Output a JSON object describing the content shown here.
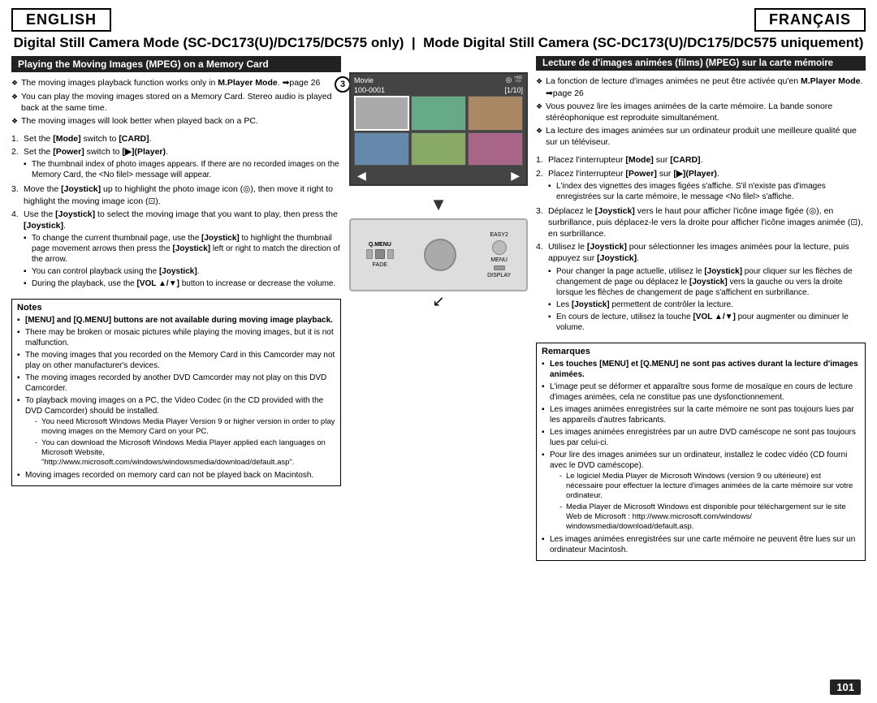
{
  "header": {
    "english_label": "ENGLISH",
    "francais_label": "FRANÇAIS"
  },
  "main_title": {
    "en": "Digital Still Camera Mode (SC-DC173(U)/DC175/DC575 only)",
    "fr": "Mode Digital Still Camera (SC-DC173(U)/DC175/DC575 uniquement)"
  },
  "english_section": {
    "header": "Playing the Moving Images (MPEG) on a Memory Card",
    "intro_bullets": [
      "The moving images playback function works only in M.Player Mode. ➡page 26",
      "You can play the moving images stored on a Memory Card. Stereo audio is played back at the same time.",
      "The moving images will look better when played back on a PC."
    ],
    "steps": [
      {
        "num": "1.",
        "text": "Set the [Mode] switch to [CARD]."
      },
      {
        "num": "2.",
        "text": "Set the [Power] switch to [▶](Player).",
        "subs": [
          "The thumbnail index of photo images appears. If there are no recorded images on the Memory Card, the <No filel> message will appear."
        ]
      },
      {
        "num": "3.",
        "text": "Move the [Joystick] up to highlight the photo image icon (◎), then move it right to highlight the moving image icon (⊡)."
      },
      {
        "num": "4.",
        "text": "Use the [Joystick] to select the moving image that you want to play, then press the [Joystick].",
        "subs": [
          "To change the current thumbnail page, use the [Joystick] to highlight the thumbnail page movement arrows then press the [Joystick] left or right to match the direction of the arrow.",
          "You can control playback using the [Joystick].",
          "During the playback, use the [VOL ▲/▼] button to increase or decrease the volume."
        ]
      }
    ],
    "notes_title": "Notes",
    "notes": [
      {
        "text": "[MENU] and [Q.MENU] buttons are not available during moving image playback.",
        "bold": true
      },
      {
        "text": "There may be broken or mosaic pictures while playing the moving images, but it is not malfunction.",
        "bold": false
      },
      {
        "text": "The moving images that you recorded on the Memory Card in this Camcorder may not play on other manufacturer's devices.",
        "bold": false
      },
      {
        "text": "The moving images recorded by another DVD Camcorder may not play on this DVD Camcorder.",
        "bold": false
      },
      {
        "text": "To playback moving images on a PC, the Video Codec (in the CD provided with the DVD Camcorder) should be installed.",
        "bold": false,
        "subs": [
          "You need Microsoft Windows Media Player Version 9 or higher version in order to play moving images on the Memory Card on your PC.",
          "You can download the Microsoft Windows Media Player applied each languages on Microsoft Website, \"http://www.microsoft.com/windows/windowsmedia/download/default.asp\"."
        ]
      },
      {
        "text": "Moving images recorded on memory card can not be played back on Macintosh.",
        "bold": false
      }
    ]
  },
  "french_section": {
    "header": "Lecture de d'images animées (films) (MPEG) sur la carte mémoire",
    "intro_bullets": [
      "La fonction de lecture d'images animées ne peut être activée qu'en M.Player Mode. ➡page 26",
      "Vous pouvez lire les images animées de la carte mémoire. La bande sonore stéréophonique est reproduite simultanément.",
      "La lecture des images animées sur un ordinateur produit une meilleure qualité que sur un téléviseur."
    ],
    "steps": [
      {
        "num": "1.",
        "text": "Placez l'interrupteur [Mode] sur [CARD]."
      },
      {
        "num": "2.",
        "text": "Placez l'interrupteur [Power] sur [▶](Player).",
        "subs": [
          "L'index des vignettes des images figées s'affiche. S'il n'existe pas d'images enregistrées sur la carte mémoire, le message <No filel> s'affiche."
        ]
      },
      {
        "num": "3.",
        "text": "Déplacez le [Joystick] vers le haut pour afficher l'icône image figée (◎), en surbrillance, puis déplacez-le vers la droite pour afficher l'icône images animée (⊡), en surbrillance."
      },
      {
        "num": "4.",
        "text": "Utilisez le [Joystick] pour sélectionner les images animées pour la lecture, puis appuyez sur [Joystick].",
        "subs": [
          "Pour changer la page actuelle, utilisez le [Joystick] pour cliquer sur les flèches de changement de page ou déplacez le [Joystick] vers la gauche ou vers la droite lorsque les flèches de changement de page s'affichent en surbrillance.",
          "Les [Joystick] permettent de contrôler la lecture.",
          "En cours de lecture, utilisez la touche [VOL ▲/▼] pour augmenter ou diminuer le volume."
        ]
      }
    ],
    "remarques_title": "Remarques",
    "notes": [
      {
        "text": "Les touches [MENU] et [Q.MENU] ne sont pas actives durant la lecture d'images animées.",
        "bold": true
      },
      {
        "text": "L'image peut se déformer et apparaître sous forme de mosaïque en cours de lecture d'images animées, cela ne constitue pas une dysfonctionnement.",
        "bold": false
      },
      {
        "text": "Les images animées enregistrées sur la carte mémoire ne sont pas toujours lues par les appareils d'autres fabricants.",
        "bold": false
      },
      {
        "text": "Les images animées enregistrées par un autre DVD caméscope ne sont pas toujours lues par celui-ci.",
        "bold": false
      },
      {
        "text": "Pour lire des images animées sur un ordinateur, installez le codec vidéo (CD fourni avec le DVD caméscope).",
        "bold": false,
        "subs": [
          "Le logiciel Media Player de Microsoft Windows (version 9 ou ultérieure) est nécessaire pour effectuer la lecture d'images animées de la carte mémoire sur votre ordinateur.",
          "Media Player de Microsoft Windows est disponible pour téléchargement sur le site Web de Microsoft : http://www.microsoft.com/windows/ windowsmedia/download/default.asp."
        ]
      },
      {
        "text": "Les images animées enregistrées sur une carte mémoire ne peuvent être lues sur un ordinateur Macintosh.",
        "bold": false
      }
    ]
  },
  "camera_display": {
    "movie_label": "Movie",
    "counter": "100-0001",
    "page": "[1/10]"
  },
  "page_number": "101"
}
